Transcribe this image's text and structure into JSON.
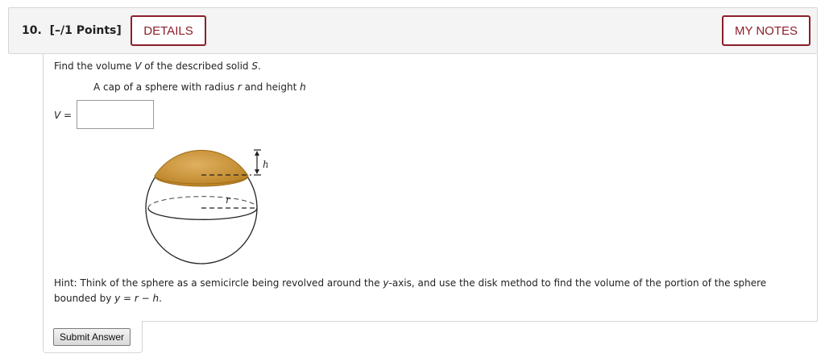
{
  "question": {
    "number": "10.",
    "points": "[–/1 Points]"
  },
  "header": {
    "details_label": "DETAILS",
    "notes_label": "MY NOTES"
  },
  "problem": {
    "prompt_pre": "Find the volume ",
    "prompt_var1": "V",
    "prompt_mid": " of the described solid ",
    "prompt_var2": "S",
    "prompt_end": ".",
    "subtitle_pre": "A cap of a sphere with radius ",
    "subtitle_r": "r",
    "subtitle_mid": " and height ",
    "subtitle_h": "h",
    "answer_var": "V",
    "answer_eq": " =",
    "answer_value": ""
  },
  "figure": {
    "label_h": "h",
    "label_r": "r",
    "cap_color": "#c8922a"
  },
  "hint": {
    "line1_pre": "Hint: Think of the sphere as a semicircle being revolved around the ",
    "line1_var": "y",
    "line1_post": "-axis, and use the disk method to find the volume of the portion of the sphere",
    "line2_pre": "bounded by ",
    "line2_eq": "y = r − h",
    "line2_post": "."
  },
  "actions": {
    "submit_label": "Submit Answer"
  },
  "colors": {
    "accent": "#8b1f2b"
  }
}
